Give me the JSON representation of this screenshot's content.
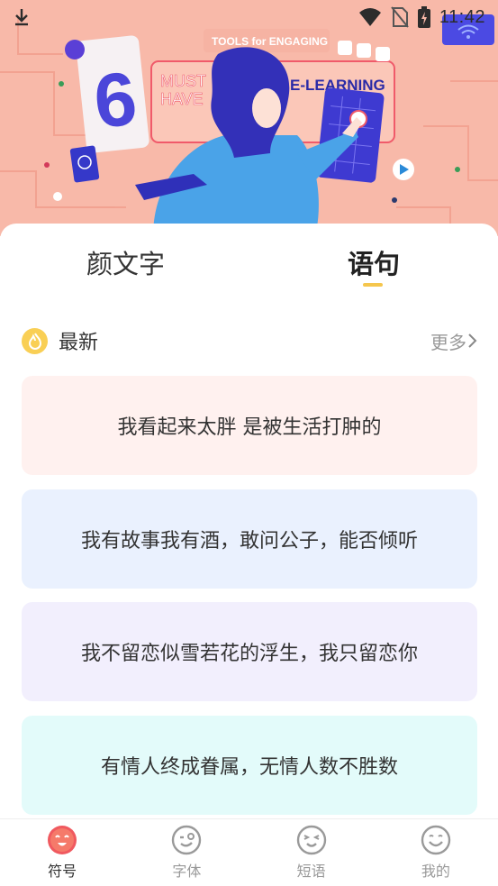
{
  "status_bar": {
    "time": "11:42",
    "icons": [
      "download-icon",
      "wifi-icon",
      "no-sim-icon",
      "battery-icon"
    ]
  },
  "banner": {
    "badge_number": "6",
    "headline_top": "TOOLS for ENGAGING",
    "must": "MUST",
    "have": "HAVE",
    "elearning": "E-LEARNING"
  },
  "tabs": [
    {
      "label": "颜文字",
      "active": false
    },
    {
      "label": "语句",
      "active": true
    }
  ],
  "section": {
    "title": "最新",
    "more_label": "更多"
  },
  "cards": [
    {
      "text": "我看起来太胖 是被生活打肿的",
      "bg": "#fff1ef"
    },
    {
      "text": "我有故事我有酒，敢问公子，能否倾听",
      "bg": "#eaf1fe"
    },
    {
      "text": "我不留恋似雪若花的浮生，我只留恋你",
      "bg": "#f2effd"
    },
    {
      "text": "有情人终成眷属，无情人数不胜数",
      "bg": "#e3fbfa"
    }
  ],
  "bottom_nav": [
    {
      "label": "符号",
      "icon": "face-smile-icon",
      "active": true
    },
    {
      "label": "字体",
      "icon": "face-wink-icon",
      "active": false
    },
    {
      "label": "短语",
      "icon": "face-squint-icon",
      "active": false
    },
    {
      "label": "我的",
      "icon": "face-happy-icon",
      "active": false
    }
  ],
  "colors": {
    "accent_yellow": "#f5c64d",
    "banner_bg": "#f8b9a9",
    "nav_active": "#f0595f"
  }
}
